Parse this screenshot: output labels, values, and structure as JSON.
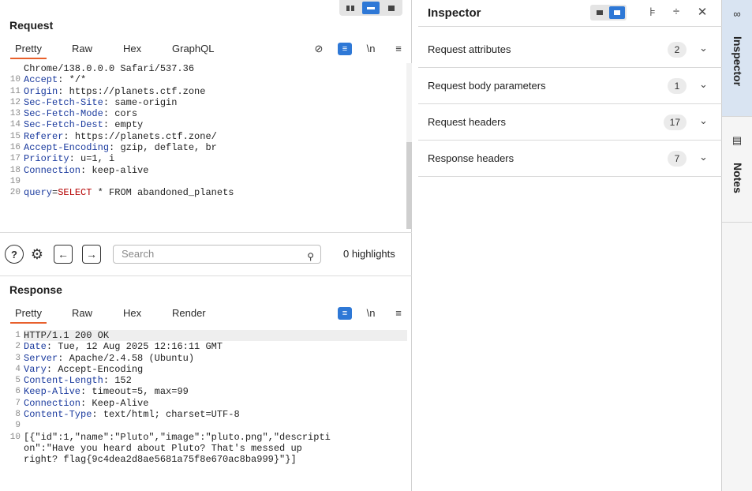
{
  "request": {
    "title": "Request",
    "tabs": [
      "Pretty",
      "Raw",
      "Hex",
      "GraphQL"
    ],
    "lines": [
      {
        "n": "",
        "key": "",
        "sep": "",
        "val": "Chrome/138.0.0.0 Safari/537.36"
      },
      {
        "n": "10",
        "key": "Accept",
        "sep": ": ",
        "val": "*/*"
      },
      {
        "n": "11",
        "key": "Origin",
        "sep": ": ",
        "val": "https://planets.ctf.zone"
      },
      {
        "n": "12",
        "key": "Sec-Fetch-Site",
        "sep": ": ",
        "val": "same-origin"
      },
      {
        "n": "13",
        "key": "Sec-Fetch-Mode",
        "sep": ": ",
        "val": "cors"
      },
      {
        "n": "14",
        "key": "Sec-Fetch-Dest",
        "sep": ": ",
        "val": "empty"
      },
      {
        "n": "15",
        "key": "Referer",
        "sep": ": ",
        "val": "https://planets.ctf.zone/"
      },
      {
        "n": "16",
        "key": "Accept-Encoding",
        "sep": ": ",
        "val": "gzip, deflate, br"
      },
      {
        "n": "17",
        "key": "Priority",
        "sep": ": ",
        "val": "u=1, i"
      },
      {
        "n": "18",
        "key": "Connection",
        "sep": ": ",
        "val": "keep-alive"
      },
      {
        "n": "19",
        "key": "",
        "sep": "",
        "val": ""
      },
      {
        "n": "20",
        "key": "query",
        "sep": "=",
        "val": "SELECT",
        "rest": " * FROM abandoned_planets"
      }
    ]
  },
  "search": {
    "placeholder": "Search",
    "highlights": "0 highlights"
  },
  "response": {
    "title": "Response",
    "tabs": [
      "Pretty",
      "Raw",
      "Hex",
      "Render"
    ],
    "lines": [
      {
        "n": "1",
        "key": "",
        "sep": "",
        "val": "HTTP/1.1 200 OK"
      },
      {
        "n": "2",
        "key": "Date",
        "sep": ": ",
        "val": "Tue, 12 Aug 2025 12:16:11 GMT"
      },
      {
        "n": "3",
        "key": "Server",
        "sep": ": ",
        "val": "Apache/2.4.58 (Ubuntu)"
      },
      {
        "n": "4",
        "key": "Vary",
        "sep": ": ",
        "val": "Accept-Encoding"
      },
      {
        "n": "5",
        "key": "Content-Length",
        "sep": ": ",
        "val": "152"
      },
      {
        "n": "6",
        "key": "Keep-Alive",
        "sep": ": ",
        "val": "timeout=5, max=99"
      },
      {
        "n": "7",
        "key": "Connection",
        "sep": ": ",
        "val": "Keep-Alive"
      },
      {
        "n": "8",
        "key": "Content-Type",
        "sep": ": ",
        "val": "text/html; charset=UTF-8"
      },
      {
        "n": "9",
        "key": "",
        "sep": "",
        "val": ""
      },
      {
        "n": "10",
        "key": "",
        "sep": "",
        "val": "[{\"id\":1,\"name\":\"Pluto\",\"image\":\"pluto.png\",\"descripti"
      },
      {
        "n": "",
        "key": "",
        "sep": "",
        "val": "on\":\"Have you heard about Pluto? That's messed up"
      },
      {
        "n": "",
        "key": "",
        "sep": "",
        "val": "right? flag{9c4dea2d8ae5681a75f8e670ac8ba999}\"}]"
      }
    ]
  },
  "inspector": {
    "title": "Inspector",
    "sections": [
      {
        "label": "Request attributes",
        "count": "2"
      },
      {
        "label": "Request body parameters",
        "count": "1"
      },
      {
        "label": "Request headers",
        "count": "17"
      },
      {
        "label": "Response headers",
        "count": "7"
      }
    ]
  },
  "rail": {
    "inspector_label": "Inspector",
    "notes_label": "Notes"
  },
  "colors": {
    "accent": "#2e78d6",
    "tab_underline": "#e8602c",
    "header_key": "#1a3a9e",
    "sql_keyword": "#b50000"
  }
}
